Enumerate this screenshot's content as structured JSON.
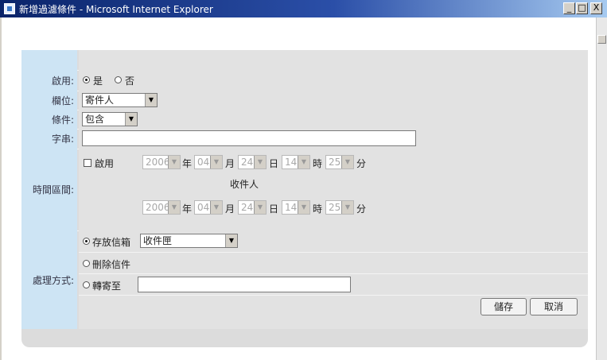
{
  "window": {
    "title": "新增過濾條件 - Microsoft Internet Explorer",
    "min_glyph": "_",
    "max_glyph": "□",
    "close_glyph": "X"
  },
  "form": {
    "enable": {
      "label": "啟用:",
      "yes": "是",
      "no": "否",
      "selected": "是"
    },
    "field": {
      "label": "欄位:",
      "value": "寄件人"
    },
    "condition": {
      "label": "條件:",
      "value": "包含"
    },
    "string": {
      "label": "字串:",
      "value": ""
    },
    "time_range": {
      "label": "時間區間:",
      "enable_label": "啟用",
      "enabled": false,
      "separator": "收件人",
      "start": {
        "year": "2006",
        "month": "04",
        "day": "24",
        "hour": "14",
        "minute": "25"
      },
      "end": {
        "year": "2006",
        "month": "04",
        "day": "24",
        "hour": "14",
        "minute": "25"
      },
      "units": {
        "year": "年",
        "month": "月",
        "day": "日",
        "hour": "時",
        "minute": "分"
      }
    },
    "action": {
      "label": "處理方式:",
      "store_label": "存放信箱",
      "store_value": "收件匣",
      "delete_label": "刪除信件",
      "forward_label": "轉寄至",
      "forward_value": "",
      "selected": "存放信箱"
    },
    "buttons": {
      "save": "儲存",
      "cancel": "取消"
    }
  }
}
